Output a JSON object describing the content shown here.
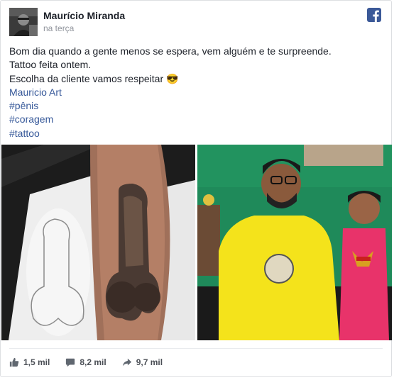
{
  "post": {
    "author": "Maurício Miranda",
    "timestamp": "na terça",
    "lines": [
      "Bom dia quando a gente menos se espera, vem alguém e te surpreende.",
      "Tattoo feita ontem.",
      "Escolha da cliente vamos respeitar 😎"
    ],
    "links": [
      "Mauricio Art",
      "#pênis",
      "#coragem",
      "#tattoo"
    ]
  },
  "stats": {
    "likes": "1,5 mil",
    "comments": "8,2 mil",
    "shares": "9,7 mil"
  },
  "icons": [
    "facebook-icon",
    "like-icon",
    "comment-icon",
    "share-icon"
  ],
  "colors": {
    "link": "#365899",
    "facebook": "#3b5998",
    "meta": "#90949c"
  }
}
